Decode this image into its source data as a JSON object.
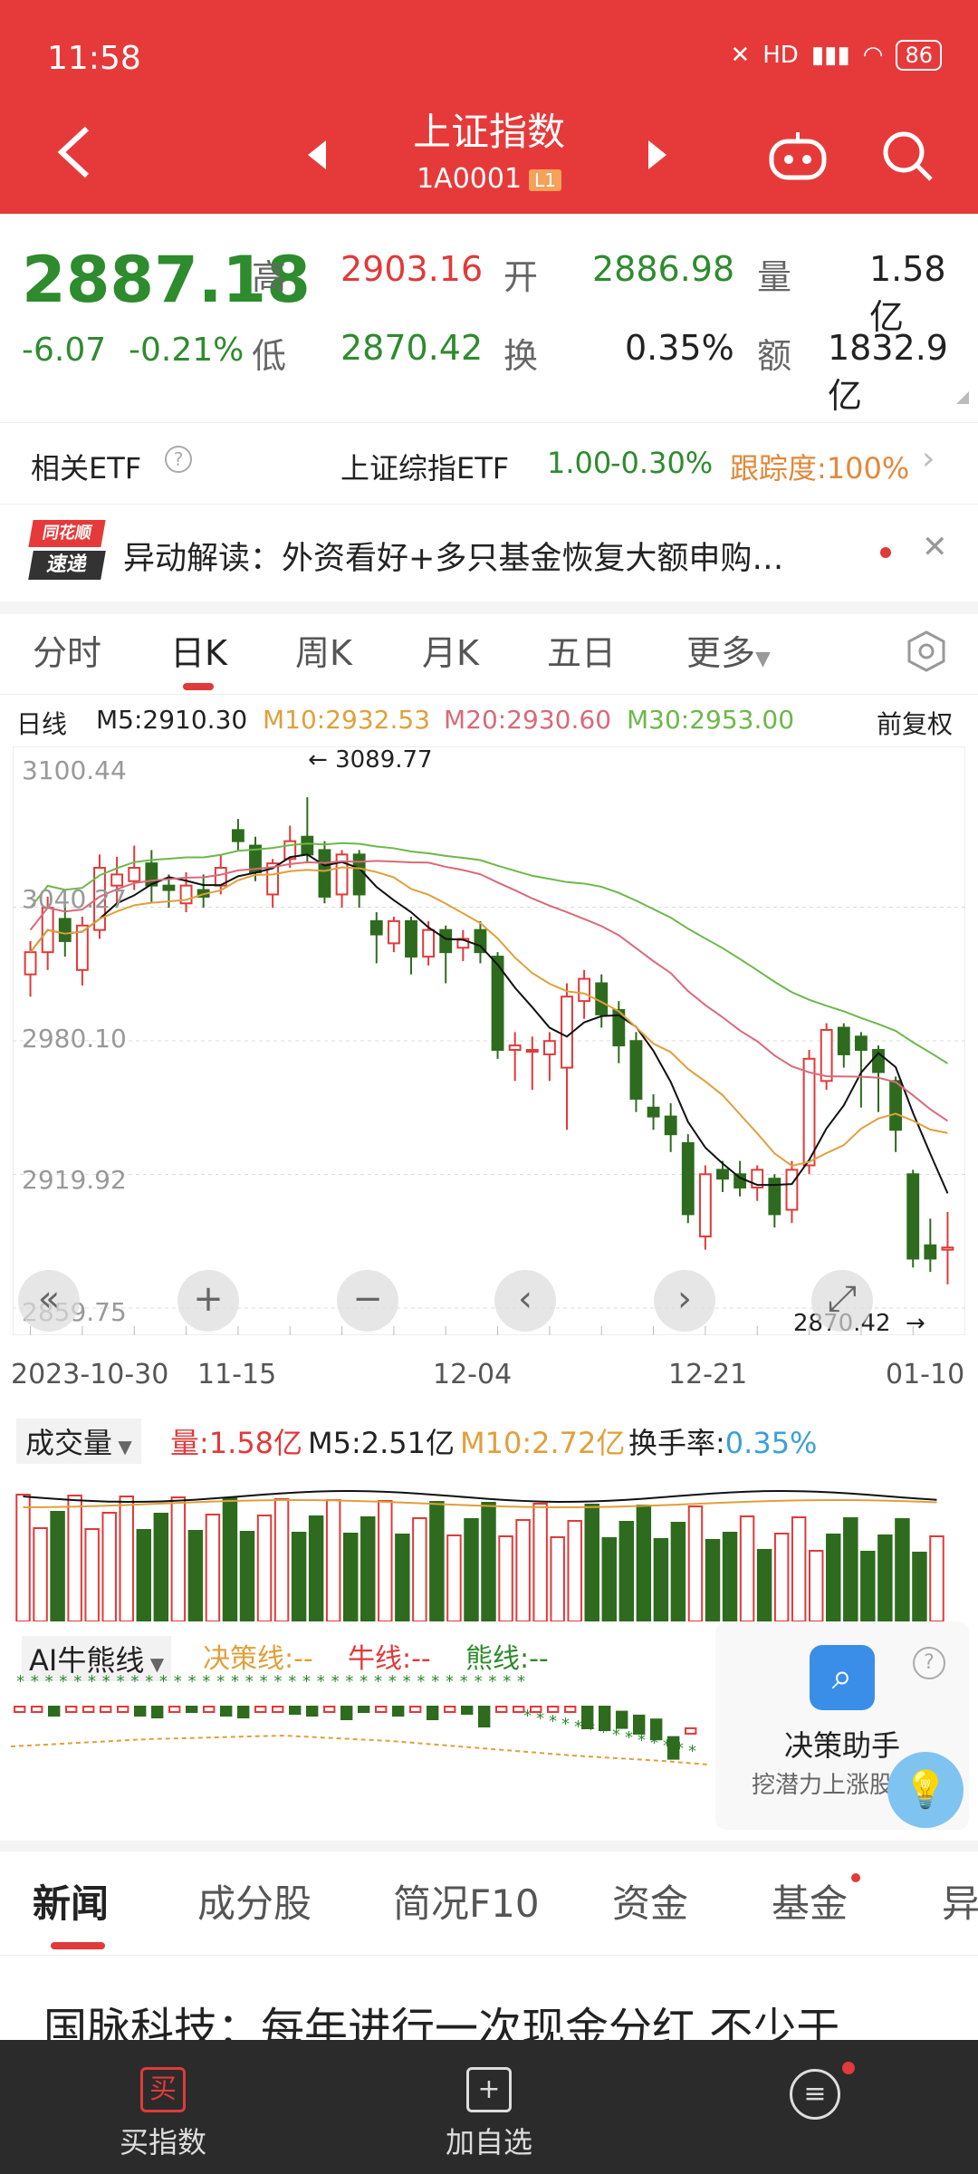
{
  "status": {
    "time": "11:58",
    "battery": "86",
    "network": "HD"
  },
  "header": {
    "title": "上证指数",
    "code": "1A0001",
    "level": "L1"
  },
  "quote": {
    "price": "2887.18",
    "change": "-6.07",
    "change_pct": "-0.21%",
    "high_label": "高",
    "high": "2903.16",
    "open_label": "开",
    "open": "2886.98",
    "vol_label": "量",
    "vol": "1.58亿",
    "low_label": "低",
    "low": "2870.42",
    "turn_label": "换",
    "turn": "0.35%",
    "amt_label": "额",
    "amt": "1832.9亿"
  },
  "etf": {
    "label": "相关ETF",
    "name": "上证综指ETF",
    "price": "1.00",
    "pct": "-0.30%",
    "track": "跟踪度:100%"
  },
  "news_banner": {
    "logo_top": "同花顺",
    "logo_bottom": "速递",
    "text": "异动解读：外资看好+多只基金恢复大额申购…"
  },
  "chart_tabs": [
    "分时",
    "日K",
    "周K",
    "月K",
    "五日",
    "更多"
  ],
  "ma": {
    "period": "日线",
    "m5": "M5:2910.30",
    "m10": "M10:2932.53",
    "m20": "M20:2930.60",
    "m30": "M30:2953.00",
    "adj": "前复权"
  },
  "chart_data": {
    "type": "candlestick",
    "y_ticks": [
      "3100.44",
      "3040.27",
      "2980.10",
      "2919.92",
      "2859.75"
    ],
    "x_ticks": [
      "2023-10-30",
      "11-15",
      "12-04",
      "12-21",
      "01-10"
    ],
    "max_label": "3089.77",
    "min_label": "2870.42",
    "ylim": [
      2859.75,
      3100.44
    ],
    "candles": [
      {
        "o": 3010,
        "c": 3020,
        "h": 3025,
        "l": 3000
      },
      {
        "o": 3020,
        "c": 3040,
        "h": 3045,
        "l": 3012
      },
      {
        "o": 3035,
        "c": 3025,
        "h": 3042,
        "l": 3018
      },
      {
        "o": 3012,
        "c": 3032,
        "h": 3036,
        "l": 3005
      },
      {
        "o": 3030,
        "c": 3058,
        "h": 3064,
        "l": 3026
      },
      {
        "o": 3050,
        "c": 3055,
        "h": 3063,
        "l": 3042
      },
      {
        "o": 3052,
        "c": 3058,
        "h": 3068,
        "l": 3048
      },
      {
        "o": 3060,
        "c": 3050,
        "h": 3066,
        "l": 3042
      },
      {
        "o": 3050,
        "c": 3048,
        "h": 3055,
        "l": 3040
      },
      {
        "o": 3042,
        "c": 3050,
        "h": 3056,
        "l": 3038
      },
      {
        "o": 3048,
        "c": 3045,
        "h": 3055,
        "l": 3040
      },
      {
        "o": 3050,
        "c": 3058,
        "h": 3064,
        "l": 3046
      },
      {
        "o": 3075,
        "c": 3070,
        "h": 3080,
        "l": 3066
      },
      {
        "o": 3068,
        "c": 3056,
        "h": 3072,
        "l": 3052
      },
      {
        "o": 3046,
        "c": 3060,
        "h": 3062,
        "l": 3040
      },
      {
        "o": 3062,
        "c": 3070,
        "h": 3077,
        "l": 3058
      },
      {
        "o": 3072,
        "c": 3064,
        "h": 3089.77,
        "l": 3060
      },
      {
        "o": 3066,
        "c": 3045,
        "h": 3070,
        "l": 3042
      },
      {
        "o": 3046,
        "c": 3064,
        "h": 3066,
        "l": 3040
      },
      {
        "o": 3064,
        "c": 3046,
        "h": 3066,
        "l": 3040
      },
      {
        "o": 3034,
        "c": 3028,
        "h": 3038,
        "l": 3015
      },
      {
        "o": 3024,
        "c": 3034,
        "h": 3036,
        "l": 3020
      },
      {
        "o": 3034,
        "c": 3018,
        "h": 3036,
        "l": 3010
      },
      {
        "o": 3018,
        "c": 3030,
        "h": 3034,
        "l": 3014
      },
      {
        "o": 3030,
        "c": 3020,
        "h": 3032,
        "l": 3006
      },
      {
        "o": 3022,
        "c": 3026,
        "h": 3030,
        "l": 3016
      },
      {
        "o": 3030,
        "c": 3020,
        "h": 3034,
        "l": 3015
      },
      {
        "o": 3018,
        "c": 2976,
        "h": 3020,
        "l": 2972
      },
      {
        "o": 2976,
        "c": 2978,
        "h": 2984,
        "l": 2962
      },
      {
        "o": 2976,
        "c": 2976,
        "h": 2982,
        "l": 2958
      },
      {
        "o": 2974,
        "c": 2980,
        "h": 2984,
        "l": 2962
      },
      {
        "o": 2968,
        "c": 3000,
        "h": 3006,
        "l": 2940
      },
      {
        "o": 2998,
        "c": 3008,
        "h": 3012,
        "l": 2990
      },
      {
        "o": 3006,
        "c": 2992,
        "h": 3010,
        "l": 2986
      },
      {
        "o": 2994,
        "c": 2978,
        "h": 2998,
        "l": 2970
      },
      {
        "o": 2980,
        "c": 2954,
        "h": 2984,
        "l": 2948
      },
      {
        "o": 2950,
        "c": 2946,
        "h": 2956,
        "l": 2940
      },
      {
        "o": 2946,
        "c": 2938,
        "h": 2952,
        "l": 2930
      },
      {
        "o": 2934,
        "c": 2902,
        "h": 2938,
        "l": 2898
      },
      {
        "o": 2892,
        "c": 2920,
        "h": 2924,
        "l": 2886
      },
      {
        "o": 2922,
        "c": 2918,
        "h": 2926,
        "l": 2912
      },
      {
        "o": 2920,
        "c": 2914,
        "h": 2926,
        "l": 2910
      },
      {
        "o": 2914,
        "c": 2922,
        "h": 2924,
        "l": 2908
      },
      {
        "o": 2918,
        "c": 2902,
        "h": 2920,
        "l": 2896
      },
      {
        "o": 2904,
        "c": 2922,
        "h": 2926,
        "l": 2898
      },
      {
        "o": 2924,
        "c": 2972,
        "h": 2976,
        "l": 2920
      },
      {
        "o": 2962,
        "c": 2985,
        "h": 2988,
        "l": 2958
      },
      {
        "o": 2986,
        "c": 2974,
        "h": 2988,
        "l": 2968
      },
      {
        "o": 2982,
        "c": 2976,
        "h": 2984,
        "l": 2950
      },
      {
        "o": 2976,
        "c": 2966,
        "h": 2978,
        "l": 2948
      },
      {
        "o": 2962,
        "c": 2940,
        "h": 2964,
        "l": 2930
      },
      {
        "o": 2920,
        "c": 2882,
        "h": 2922,
        "l": 2878
      },
      {
        "o": 2888,
        "c": 2882,
        "h": 2900,
        "l": 2876
      },
      {
        "o": 2886,
        "c": 2887,
        "h": 2903,
        "l": 2870.42
      }
    ]
  },
  "volume": {
    "label": "成交量",
    "vol": "量:1.58亿",
    "m5": "M5:2.51亿",
    "m10": "M10:2.72亿",
    "turn_label": "换手率:",
    "turn": "0.35%"
  },
  "ai": {
    "label": "AI牛熊线",
    "d1": "决策线:--",
    "d2": "牛线:--",
    "d3": "熊线:--"
  },
  "assistant": {
    "title": "决策助手",
    "sub": "挖潜力上涨股"
  },
  "bottom_tabs": [
    "新闻",
    "成分股",
    "简况F10",
    "资金",
    "基金",
    "异"
  ],
  "headline": "国脉科技：每年进行一次现金分红 不少于",
  "bottombar": {
    "buy": "买指数",
    "add": "加自选",
    "buy_icon": "买"
  }
}
